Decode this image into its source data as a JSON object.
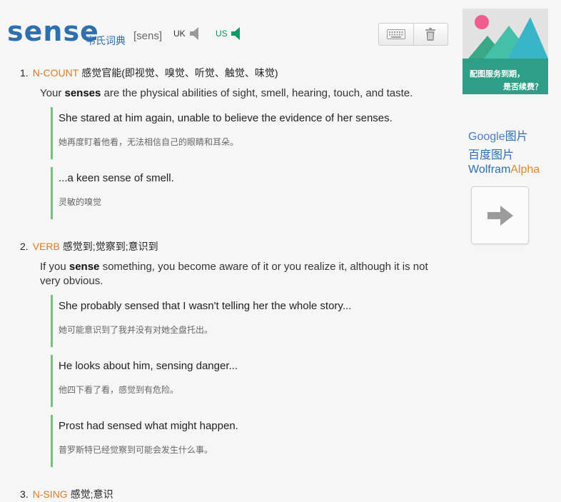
{
  "headword": "sense",
  "dict_tag": "韦氏词典",
  "phonetic": "[sens]",
  "uk_label": "UK",
  "us_label": "US",
  "ad": {
    "line1": "配图服务到期，",
    "line2": "是否续费？"
  },
  "links": {
    "google_a": "Google",
    "google_b": "图片",
    "baidu": "百度图片",
    "wolfram_a": "Wolfram",
    "wolfram_b": "Alpha"
  },
  "senses": [
    {
      "num": "1.",
      "pos": "N-COUNT",
      "cn": "感觉官能(即视觉、嗅觉、听觉、触觉、味觉)",
      "def_pre": "Your ",
      "def_kw": "senses",
      "def_post": " are the physical abilities of sight, smell, hearing, touch, and taste.",
      "examples": [
        {
          "en": "She stared at him again, unable to believe the evidence of her senses.",
          "zh": "她再度盯着他看，无法相信自己的眼睛和耳朵。"
        },
        {
          "en": "...a keen sense of smell.",
          "zh": "灵敏的嗅觉"
        }
      ]
    },
    {
      "num": "2.",
      "pos": "VERB",
      "cn": "感觉到;觉察到;意识到",
      "def_pre": "If you ",
      "def_kw": "sense",
      "def_post": " something, you become aware of it or you realize it, although it is not very obvious.",
      "examples": [
        {
          "en": "She probably sensed that I wasn't telling her the whole story...",
          "zh": "她可能意识到了我并没有对她全盘托出。"
        },
        {
          "en": "He looks about him, sensing danger...",
          "zh": "他四下看了看，感觉到有危险。"
        },
        {
          "en": "Prost had sensed what might happen.",
          "zh": "普罗斯特已经觉察到可能会发生什么事。"
        }
      ]
    },
    {
      "num": "3.",
      "pos": "N-SING",
      "cn": "感觉;意识"
    }
  ],
  "colors": {
    "accent": "#2f6fb0",
    "pos": "#e27a25",
    "example_bar": "#6fc47a",
    "ad_bar": "#2c9f86"
  }
}
